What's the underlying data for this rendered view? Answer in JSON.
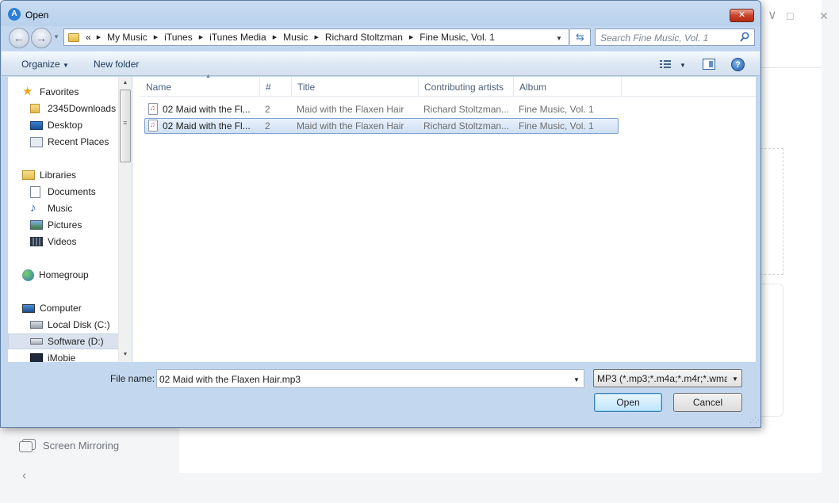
{
  "background_app": {
    "sidebar_item_label": "Screen Mirroring",
    "window_controls": {
      "minimize": "∨",
      "maximize": "□",
      "close": "✕"
    },
    "collapse_glyph": "‹"
  },
  "dialog": {
    "title": "Open",
    "close_glyph": "✕"
  },
  "address_bar": {
    "overflow": "«",
    "crumbs": [
      "My Music",
      "iTunes",
      "iTunes Media",
      "Music",
      "Richard Stoltzman",
      "Fine Music, Vol. 1"
    ],
    "refresh_glyph": "⇆"
  },
  "search": {
    "placeholder": "Search Fine Music, Vol. 1"
  },
  "toolbar": {
    "organize_label": "Organize",
    "new_folder_label": "New folder",
    "help_glyph": "?"
  },
  "nav_pane": {
    "favorites": {
      "label": "Favorites",
      "items": [
        "2345Downloads",
        "Desktop",
        "Recent Places"
      ]
    },
    "libraries": {
      "label": "Libraries",
      "items": [
        "Documents",
        "Music",
        "Pictures",
        "Videos"
      ]
    },
    "homegroup": {
      "label": "Homegroup"
    },
    "computer": {
      "label": "Computer",
      "items": [
        "Local Disk (C:)",
        "Software (D:)",
        "iMobie"
      ]
    }
  },
  "file_list": {
    "columns": {
      "name": "Name",
      "number": "#",
      "title": "Title",
      "artists": "Contributing artists",
      "album": "Album"
    },
    "rows": [
      {
        "name": "02 Maid with the Fl...",
        "number": "2",
        "title": "Maid with the Flaxen Hair",
        "artists": "Richard Stoltzman...",
        "album": "Fine Music, Vol. 1",
        "selected": false
      },
      {
        "name": "02 Maid with the Fl...",
        "number": "2",
        "title": "Maid with the Flaxen Hair",
        "artists": "Richard Stoltzman...",
        "album": "Fine Music, Vol. 1",
        "selected": true
      }
    ]
  },
  "bottom": {
    "filename_label": "File name:",
    "filename_value": "02 Maid with the Flaxen Hair.mp3",
    "filetype_value": "MP3 (*.mp3;*.m4a;*.m4r;*.wma",
    "open_label": "Open",
    "cancel_label": "Cancel"
  }
}
